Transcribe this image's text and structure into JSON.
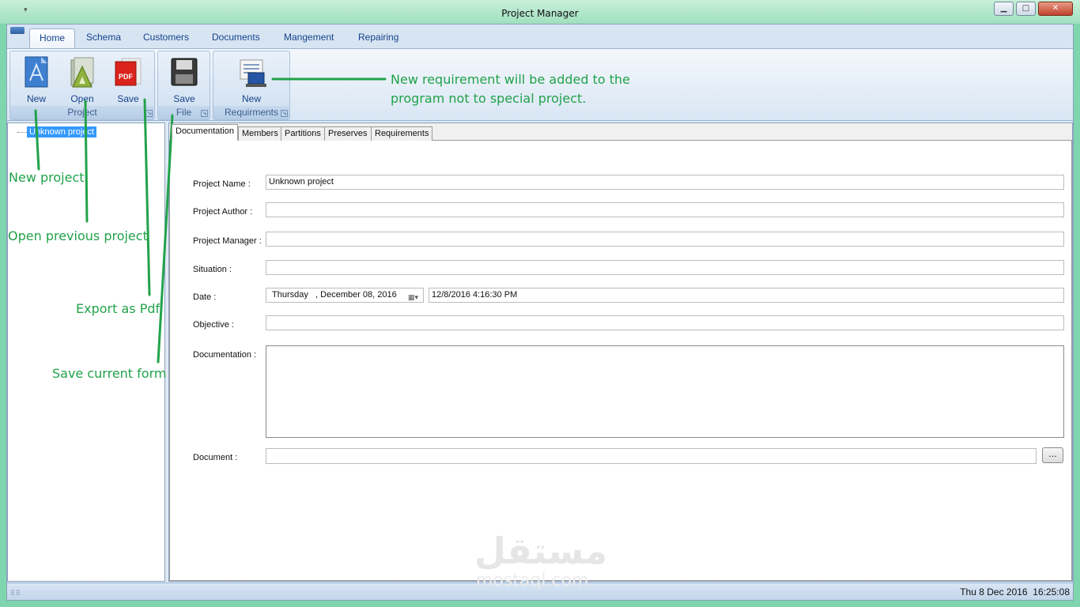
{
  "window": {
    "title": "Project Manager",
    "quick_access": "▾"
  },
  "ribbon_tabs": [
    "Home",
    "Schema",
    "Customers",
    "Documents",
    "Mangement",
    "Repairing"
  ],
  "groups": {
    "project": {
      "label": "Project",
      "buttons": {
        "new": "New",
        "open": "Open",
        "save": "Save"
      }
    },
    "file": {
      "label": "File",
      "buttons": {
        "save": "Save"
      }
    },
    "requirments": {
      "label": "Requirments",
      "buttons": {
        "new": "New"
      }
    }
  },
  "tree": {
    "root": "Unknown project"
  },
  "page_tabs": [
    "Documentation",
    "Members",
    "Partitions",
    "Preserves",
    "Requirements"
  ],
  "form": {
    "project_name_label": "Project Name :",
    "project_name_value": "Unknown project",
    "project_author_label": "Project Author :",
    "project_manager_label": "Project Manager :",
    "situation_label": "Situation :",
    "date_label": "Date :",
    "date_picker_value": "Thursday   , December 08, 2016",
    "date_time_value": "12/8/2016 4:16:30 PM",
    "objective_label": "Objective :",
    "documentation_label": "Documentation :",
    "document_label": "Document :",
    "browse_label": "..."
  },
  "status": {
    "datetime": "Thu 8 Dec 2016  16:25:08"
  },
  "annotations": {
    "new_req": "New requirement will be added to the",
    "new_req2": "program not to special project.",
    "new_project": "New project",
    "open_project": "Open previous project",
    "export_pdf": "Export as Pdf",
    "save_form": "Save current form"
  },
  "watermark": {
    "arabic": "مستقل",
    "latin": "mostaql.com"
  },
  "colors": {
    "annotation": "#22a24a",
    "selection": "#3399ff",
    "ribbon_text": "#15428b"
  }
}
